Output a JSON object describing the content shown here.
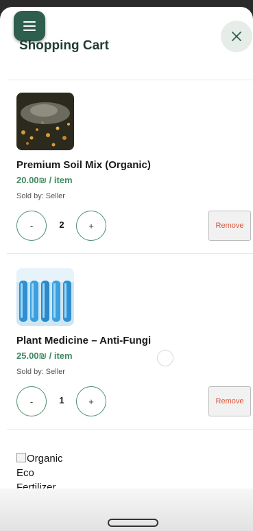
{
  "header": {
    "title": "Shopping Cart",
    "menu_icon": "hamburger-menu-icon",
    "close_icon": "close-icon"
  },
  "cart": {
    "items": [
      {
        "name": "Premium Soil Mix (Organic)",
        "price": "20.00₪ / item",
        "seller": "Sold by: Seller",
        "quantity": "2",
        "decrement_label": "-",
        "increment_label": "+",
        "remove_label": "Remove"
      },
      {
        "name": "Plant Medicine – Anti-Fungi",
        "price": "25.00₪ / item",
        "seller": "Sold by: Seller",
        "quantity": "1",
        "decrement_label": "-",
        "increment_label": "+",
        "remove_label": "Remove"
      }
    ],
    "broken_image_alt": [
      "Organic",
      "Eco",
      "Fertilizer"
    ]
  },
  "colors": {
    "brand_green": "#2e5e4e",
    "price_green": "#3f8a60",
    "remove_red": "#d6563a"
  }
}
